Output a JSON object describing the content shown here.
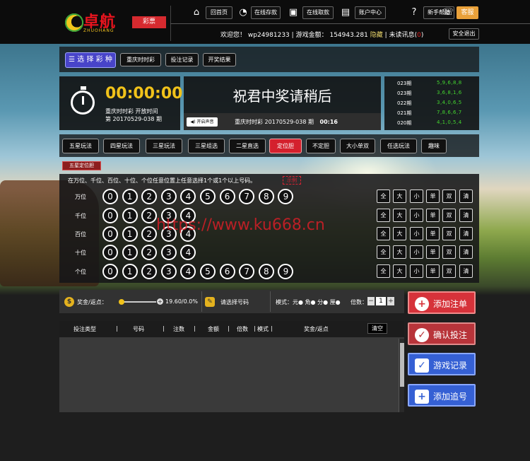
{
  "brand": {
    "name": "卓航",
    "tagline": "ZHUOHANG",
    "caipiao": "彩票"
  },
  "nav": [
    "回首页",
    "在线存款",
    "在线取款",
    "账户中心",
    "新手帮助"
  ],
  "kefu": "客服",
  "account": {
    "welcome": "欢迎您！",
    "user": "wp24981233",
    "sep1": "|",
    "balance_label": "游戏金额：",
    "balance": "154943.281",
    "hide": "隐藏",
    "sep2": "|",
    "unread_label": "未读讯息(",
    "unread": "0",
    "unread_end": ")",
    "logout": "安全退出"
  },
  "toolbar": {
    "choose": "选 择 彩 种",
    "buttons": [
      "重庆时时彩",
      "投注记录",
      "开奖结果"
    ]
  },
  "timer": {
    "time": "00:00:00",
    "line1": "重庆时时彩 开放时间",
    "line2": "第 20170529-038 期"
  },
  "announce": {
    "text": "祝君中奖请稍后",
    "sound": "开启声音",
    "issue": "重庆时时彩",
    "period": "20170529-038 期",
    "countdown": "00:16"
  },
  "results": [
    {
      "period": "023期",
      "nums": "5,9,6,8,8"
    },
    {
      "period": "023期",
      "nums": "3,6,8,1,6"
    },
    {
      "period": "022期",
      "nums": "3,4,0,6,5"
    },
    {
      "period": "021期",
      "nums": "7,8,6,6,7"
    },
    {
      "period": "020期",
      "nums": "4,1,0,5,4"
    }
  ],
  "tabs": [
    "五星玩法",
    "四星玩法",
    "三星玩法",
    "三星组选",
    "二星直选",
    "定位胆",
    "不定胆",
    "大小单双",
    "任选玩法",
    "趣味"
  ],
  "active_tab": "定位胆",
  "subtab": "五星定位胆",
  "hint": "在万位、千位、百位、十位、个位任意位置上任意选择1个或1个以上号码。",
  "example": "示例",
  "positions": [
    {
      "label": "万位",
      "digits": [
        "0",
        "1",
        "2",
        "3",
        "4",
        "5",
        "6",
        "7",
        "8",
        "9"
      ]
    },
    {
      "label": "千位",
      "digits": [
        "0",
        "1",
        "2",
        "3",
        "4"
      ]
    },
    {
      "label": "百位",
      "digits": [
        "0",
        "1",
        "2",
        "3",
        "4"
      ]
    },
    {
      "label": "十位",
      "digits": [
        "0",
        "1",
        "2",
        "3",
        "4"
      ]
    },
    {
      "label": "个位",
      "digits": [
        "0",
        "1",
        "2",
        "3",
        "4",
        "5",
        "6",
        "7",
        "8",
        "9"
      ]
    }
  ],
  "quick": [
    "全",
    "大",
    "小",
    "单",
    "双",
    "清"
  ],
  "watermark": "https://www.ku668.cn",
  "bet": {
    "rebate_label": "奖金/返点：",
    "rebate_value": "19.60/0.0%",
    "select_label": "请选择号码",
    "mode_label": "模式：",
    "modes": [
      "元",
      "角",
      "分",
      "厘"
    ],
    "mult_label": "倍数：",
    "mult": "1"
  },
  "table_headers": [
    "投注类型",
    "号码",
    "注数",
    "金额",
    "倍数",
    "模式",
    "奖金/返点"
  ],
  "clear": "清空",
  "actions": [
    "添加注单",
    "确认投注",
    "游戏记录",
    "添加追号"
  ]
}
